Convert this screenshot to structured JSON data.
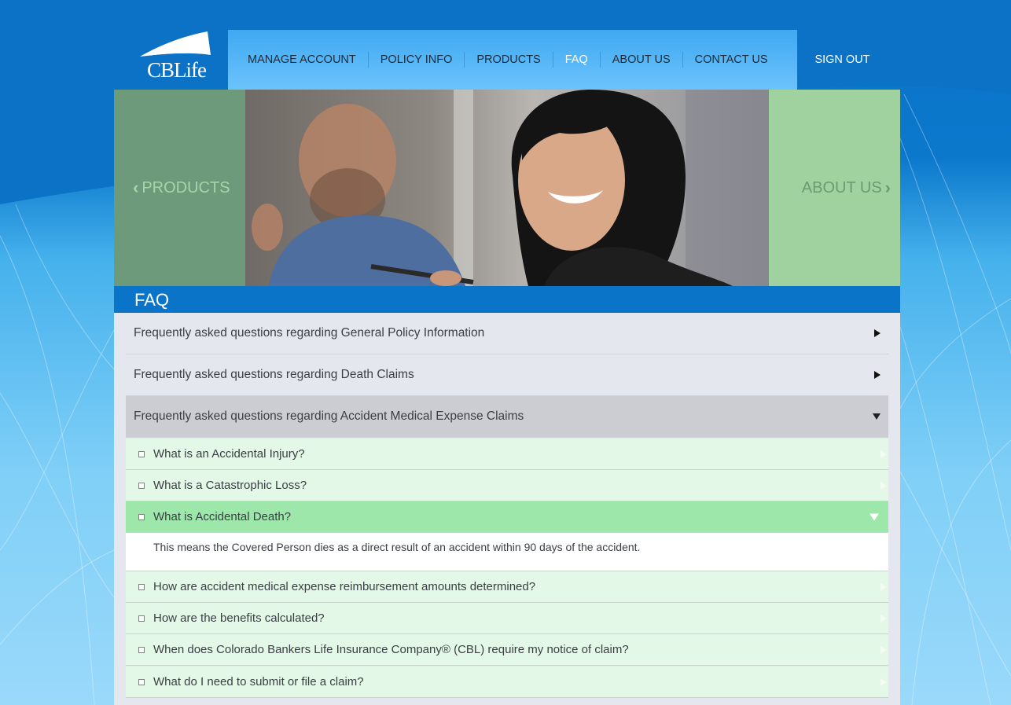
{
  "brand": {
    "logo_text": "CBLife"
  },
  "nav": {
    "items": [
      {
        "label": "MANAGE ACCOUNT",
        "active": false
      },
      {
        "label": "POLICY INFO",
        "active": false
      },
      {
        "label": "PRODUCTS",
        "active": false
      },
      {
        "label": "FAQ",
        "active": true
      },
      {
        "label": "ABOUT US",
        "active": false
      },
      {
        "label": "CONTACT US",
        "active": false
      }
    ],
    "sign_out": "SIGN OUT"
  },
  "banner": {
    "prev_label": "PRODUCTS",
    "next_label": "ABOUT US",
    "prev_icon": "chevron-left-icon",
    "next_icon": "chevron-right-icon"
  },
  "page_title": "FAQ",
  "categories": [
    {
      "label": "Frequently asked questions regarding General Policy Information",
      "expanded": false
    },
    {
      "label": "Frequently asked questions regarding Death Claims",
      "expanded": false
    },
    {
      "label": "Frequently asked questions regarding Accident Medical Expense Claims",
      "expanded": true
    }
  ],
  "questions": [
    {
      "label": "What is an Accidental Injury?",
      "expanded": false
    },
    {
      "label": "What is a Catastrophic Loss?",
      "expanded": false
    },
    {
      "label": "What is Accidental Death?",
      "expanded": true
    },
    {
      "label": "How are accident medical expense reimbursement amounts determined?",
      "expanded": false
    },
    {
      "label": "How are the benefits calculated?",
      "expanded": false
    },
    {
      "label": "When does Colorado Bankers Life Insurance Company® (CBL) require my notice of claim?",
      "expanded": false
    },
    {
      "label": "What do I need to submit or file a claim?",
      "expanded": false
    }
  ],
  "answer": "This means the Covered Person dies as a direct result of an accident within 90 days of the accident.",
  "colors": {
    "primary_blue": "#0a74c9",
    "nav_blue": "#5cbaf8",
    "category_open": "#cbcdd3",
    "question_bg": "#e3f8e6",
    "question_open": "#9de7ab",
    "banner_left": "#6e9a7c",
    "banner_right": "#a0d2a0"
  }
}
